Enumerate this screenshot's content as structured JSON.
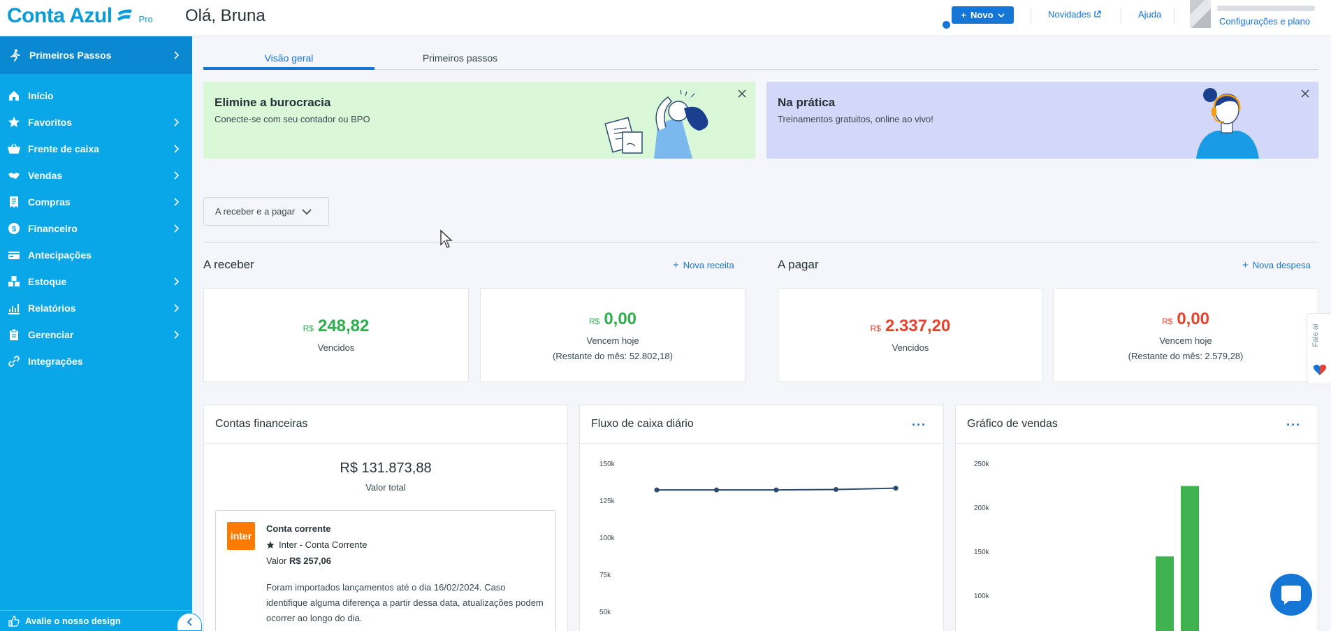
{
  "header": {
    "logo_text": "Conta Azul",
    "logo_badge": "Pro",
    "greeting": "Olá, Bruna",
    "new_button": "Novo",
    "news_link": "Novidades",
    "help_link": "Ajuda",
    "config_link": "Configurações e plano"
  },
  "sidebar": {
    "first_steps": "Primeiros Passos",
    "items": [
      {
        "label": "Início",
        "icon": "home-icon",
        "has_submenu": false
      },
      {
        "label": "Favoritos",
        "icon": "star-icon",
        "has_submenu": true
      },
      {
        "label": "Frente de caixa",
        "icon": "basket-icon",
        "has_submenu": true
      },
      {
        "label": "Vendas",
        "icon": "handshake-icon",
        "has_submenu": true
      },
      {
        "label": "Compras",
        "icon": "receipt-icon",
        "has_submenu": true
      },
      {
        "label": "Financeiro",
        "icon": "dollar-icon",
        "has_submenu": true
      },
      {
        "label": "Antecipações",
        "icon": "card-icon",
        "has_submenu": false
      },
      {
        "label": "Estoque",
        "icon": "boxes-icon",
        "has_submenu": true
      },
      {
        "label": "Relatórios",
        "icon": "chart-icon",
        "has_submenu": true
      },
      {
        "label": "Gerenciar",
        "icon": "clipboard-icon",
        "has_submenu": true
      },
      {
        "label": "Integrações",
        "icon": "link-icon",
        "has_submenu": false
      }
    ],
    "rate_design": "Avalie o nosso design"
  },
  "tabs": [
    {
      "label": "Visão geral",
      "active": true
    },
    {
      "label": "Primeiros passos",
      "active": false
    }
  ],
  "banners": [
    {
      "title": "Elimine a burocracia",
      "subtitle": "Conecte-se com seu contador ou BPO",
      "bg": "#d9f8d8"
    },
    {
      "title": "Na prática",
      "subtitle": "Treinamentos gratuitos, online ao vivo!",
      "bg": "#d3d7f8"
    }
  ],
  "filter_dropdown": "A receber e a pagar",
  "receivable": {
    "title": "A receber",
    "action": "Nova receita",
    "cards": [
      {
        "currency": "R$",
        "amount": "248,82",
        "label": "Vencidos",
        "sub": ""
      },
      {
        "currency": "R$",
        "amount": "0,00",
        "label": "Vencem hoje",
        "sub": "(Restante do mês: 52.802,18)"
      }
    ]
  },
  "payable": {
    "title": "A pagar",
    "action": "Nova despesa",
    "cards": [
      {
        "currency": "R$",
        "amount": "2.337,20",
        "label": "Vencidos",
        "sub": ""
      },
      {
        "currency": "R$",
        "amount": "0,00",
        "label": "Vencem hoje",
        "sub": "(Restante do mês: 2.579,28)"
      }
    ]
  },
  "accounts_widget": {
    "title": "Contas financeiras",
    "total": "R$ 131.873,88",
    "total_label": "Valor total",
    "account": {
      "logo": "inter",
      "type": "Conta corrente",
      "bank": "Inter - Conta Corrente",
      "value_label": "Valor",
      "value": "R$ 257,06",
      "note": "Foram importados lançamentos até o dia 16/02/2024. Caso identifique alguma diferença a partir dessa data, atualizações podem ocorrer ao longo do dia."
    }
  },
  "cashflow_widget": {
    "title": "Fluxo de caixa diário",
    "more": "···"
  },
  "sales_widget": {
    "title": "Gráfico de vendas",
    "more": "···"
  },
  "chart_data": [
    {
      "type": "line",
      "x": [
        1,
        2,
        3,
        4,
        5
      ],
      "values": [
        132500,
        132500,
        132500,
        132800,
        133700
      ],
      "y_ticks": [
        "150k",
        "125k",
        "100k",
        "75k",
        "50k"
      ],
      "ylim_visible": [
        50000,
        150000
      ],
      "color": "#2b4a6f"
    },
    {
      "type": "bar",
      "values": [
        145000,
        225000
      ],
      "y_ticks": [
        "250k",
        "200k",
        "150k",
        "100k"
      ],
      "ylim_visible": [
        100000,
        250000
      ],
      "color": "#3fb24f"
    }
  ],
  "side_tab": "Fale aí",
  "colors": {
    "brand": "#0aa7e8",
    "primary": "#1676d6",
    "positive": "#2eae4e",
    "negative": "#e8412d"
  }
}
